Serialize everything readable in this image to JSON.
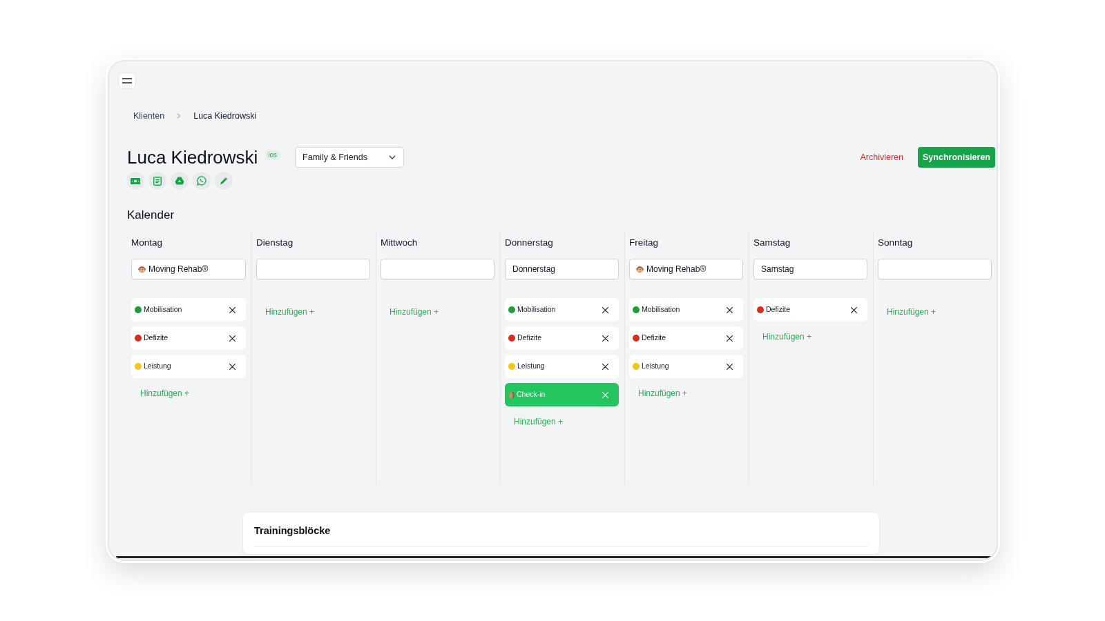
{
  "breadcrumb": [
    "Klienten",
    "Luca Kiedrowski"
  ],
  "client": {
    "name": "Luca Kiedrowski",
    "platform": "ios",
    "plan": "Family & Friends"
  },
  "actions": {
    "archive": "Archivieren",
    "sync": "Synchronisieren"
  },
  "calendar": {
    "title": "Kalender",
    "days": [
      {
        "name": "Montag",
        "field": {
          "value": "Moving Rehab®",
          "has_icon": true
        },
        "items": [
          {
            "kind": "tag",
            "label": "Mobilisation",
            "color": "#1f9d36"
          },
          {
            "kind": "tag",
            "label": "Defizite",
            "color": "#d92d20"
          },
          {
            "kind": "tag",
            "label": "Leistung",
            "color": "#f5c518"
          }
        ],
        "add_label": "Hinzufügen +"
      },
      {
        "name": "Dienstag",
        "add_label": "Hinzufügen +"
      },
      {
        "name": "Mittwoch",
        "add_label": "Hinzufügen +"
      },
      {
        "name": "Donnerstag",
        "field": {
          "value": "Donnerstag"
        },
        "items": [
          {
            "kind": "tag",
            "label": "Mobilisation",
            "color": "#1f9d36"
          },
          {
            "kind": "tag",
            "label": "Defizite",
            "color": "#d92d20"
          },
          {
            "kind": "tag",
            "label": "Leistung",
            "color": "#f5c518"
          },
          {
            "kind": "check_in",
            "label": "Check-in"
          }
        ],
        "add_label": "Hinzufügen +"
      },
      {
        "name": "Freitag",
        "field": {
          "value": "Moving Rehab®",
          "has_icon": true
        },
        "items": [
          {
            "kind": "tag",
            "label": "Mobilisation",
            "color": "#1f9d36"
          },
          {
            "kind": "tag",
            "label": "Defizite",
            "color": "#d92d20"
          },
          {
            "kind": "tag",
            "label": "Leistung",
            "color": "#f5c518"
          }
        ],
        "add_label": "Hinzufügen +"
      },
      {
        "name": "Samstag",
        "field": {
          "value": "Samstag"
        },
        "items": [
          {
            "kind": "tag",
            "label": "Defizite",
            "color": "#d92d20"
          }
        ],
        "add_label": "Hinzufügen +"
      },
      {
        "name": "Sonntag",
        "add_label": "Hinzufügen +"
      }
    ]
  },
  "training_blocks": {
    "title": "Trainingsblöcke"
  }
}
